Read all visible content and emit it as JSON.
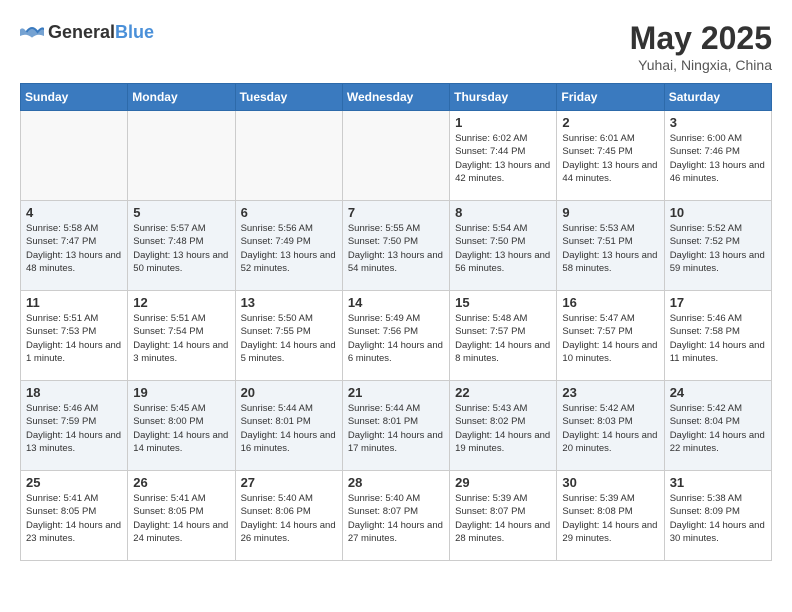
{
  "header": {
    "logo_general": "General",
    "logo_blue": "Blue",
    "month_year": "May 2025",
    "location": "Yuhai, Ningxia, China"
  },
  "weekdays": [
    "Sunday",
    "Monday",
    "Tuesday",
    "Wednesday",
    "Thursday",
    "Friday",
    "Saturday"
  ],
  "weeks": [
    [
      {
        "day": "",
        "empty": true
      },
      {
        "day": "",
        "empty": true
      },
      {
        "day": "",
        "empty": true
      },
      {
        "day": "",
        "empty": true
      },
      {
        "day": "1",
        "sunrise": "6:02 AM",
        "sunset": "7:44 PM",
        "daylight": "13 hours and 42 minutes."
      },
      {
        "day": "2",
        "sunrise": "6:01 AM",
        "sunset": "7:45 PM",
        "daylight": "13 hours and 44 minutes."
      },
      {
        "day": "3",
        "sunrise": "6:00 AM",
        "sunset": "7:46 PM",
        "daylight": "13 hours and 46 minutes."
      }
    ],
    [
      {
        "day": "4",
        "sunrise": "5:58 AM",
        "sunset": "7:47 PM",
        "daylight": "13 hours and 48 minutes."
      },
      {
        "day": "5",
        "sunrise": "5:57 AM",
        "sunset": "7:48 PM",
        "daylight": "13 hours and 50 minutes."
      },
      {
        "day": "6",
        "sunrise": "5:56 AM",
        "sunset": "7:49 PM",
        "daylight": "13 hours and 52 minutes."
      },
      {
        "day": "7",
        "sunrise": "5:55 AM",
        "sunset": "7:50 PM",
        "daylight": "13 hours and 54 minutes."
      },
      {
        "day": "8",
        "sunrise": "5:54 AM",
        "sunset": "7:50 PM",
        "daylight": "13 hours and 56 minutes."
      },
      {
        "day": "9",
        "sunrise": "5:53 AM",
        "sunset": "7:51 PM",
        "daylight": "13 hours and 58 minutes."
      },
      {
        "day": "10",
        "sunrise": "5:52 AM",
        "sunset": "7:52 PM",
        "daylight": "13 hours and 59 minutes."
      }
    ],
    [
      {
        "day": "11",
        "sunrise": "5:51 AM",
        "sunset": "7:53 PM",
        "daylight": "14 hours and 1 minute."
      },
      {
        "day": "12",
        "sunrise": "5:51 AM",
        "sunset": "7:54 PM",
        "daylight": "14 hours and 3 minutes."
      },
      {
        "day": "13",
        "sunrise": "5:50 AM",
        "sunset": "7:55 PM",
        "daylight": "14 hours and 5 minutes."
      },
      {
        "day": "14",
        "sunrise": "5:49 AM",
        "sunset": "7:56 PM",
        "daylight": "14 hours and 6 minutes."
      },
      {
        "day": "15",
        "sunrise": "5:48 AM",
        "sunset": "7:57 PM",
        "daylight": "14 hours and 8 minutes."
      },
      {
        "day": "16",
        "sunrise": "5:47 AM",
        "sunset": "7:57 PM",
        "daylight": "14 hours and 10 minutes."
      },
      {
        "day": "17",
        "sunrise": "5:46 AM",
        "sunset": "7:58 PM",
        "daylight": "14 hours and 11 minutes."
      }
    ],
    [
      {
        "day": "18",
        "sunrise": "5:46 AM",
        "sunset": "7:59 PM",
        "daylight": "14 hours and 13 minutes."
      },
      {
        "day": "19",
        "sunrise": "5:45 AM",
        "sunset": "8:00 PM",
        "daylight": "14 hours and 14 minutes."
      },
      {
        "day": "20",
        "sunrise": "5:44 AM",
        "sunset": "8:01 PM",
        "daylight": "14 hours and 16 minutes."
      },
      {
        "day": "21",
        "sunrise": "5:44 AM",
        "sunset": "8:01 PM",
        "daylight": "14 hours and 17 minutes."
      },
      {
        "day": "22",
        "sunrise": "5:43 AM",
        "sunset": "8:02 PM",
        "daylight": "14 hours and 19 minutes."
      },
      {
        "day": "23",
        "sunrise": "5:42 AM",
        "sunset": "8:03 PM",
        "daylight": "14 hours and 20 minutes."
      },
      {
        "day": "24",
        "sunrise": "5:42 AM",
        "sunset": "8:04 PM",
        "daylight": "14 hours and 22 minutes."
      }
    ],
    [
      {
        "day": "25",
        "sunrise": "5:41 AM",
        "sunset": "8:05 PM",
        "daylight": "14 hours and 23 minutes."
      },
      {
        "day": "26",
        "sunrise": "5:41 AM",
        "sunset": "8:05 PM",
        "daylight": "14 hours and 24 minutes."
      },
      {
        "day": "27",
        "sunrise": "5:40 AM",
        "sunset": "8:06 PM",
        "daylight": "14 hours and 26 minutes."
      },
      {
        "day": "28",
        "sunrise": "5:40 AM",
        "sunset": "8:07 PM",
        "daylight": "14 hours and 27 minutes."
      },
      {
        "day": "29",
        "sunrise": "5:39 AM",
        "sunset": "8:07 PM",
        "daylight": "14 hours and 28 minutes."
      },
      {
        "day": "30",
        "sunrise": "5:39 AM",
        "sunset": "8:08 PM",
        "daylight": "14 hours and 29 minutes."
      },
      {
        "day": "31",
        "sunrise": "5:38 AM",
        "sunset": "8:09 PM",
        "daylight": "14 hours and 30 minutes."
      }
    ]
  ],
  "labels": {
    "sunrise": "Sunrise:",
    "sunset": "Sunset:",
    "daylight": "Daylight:"
  }
}
